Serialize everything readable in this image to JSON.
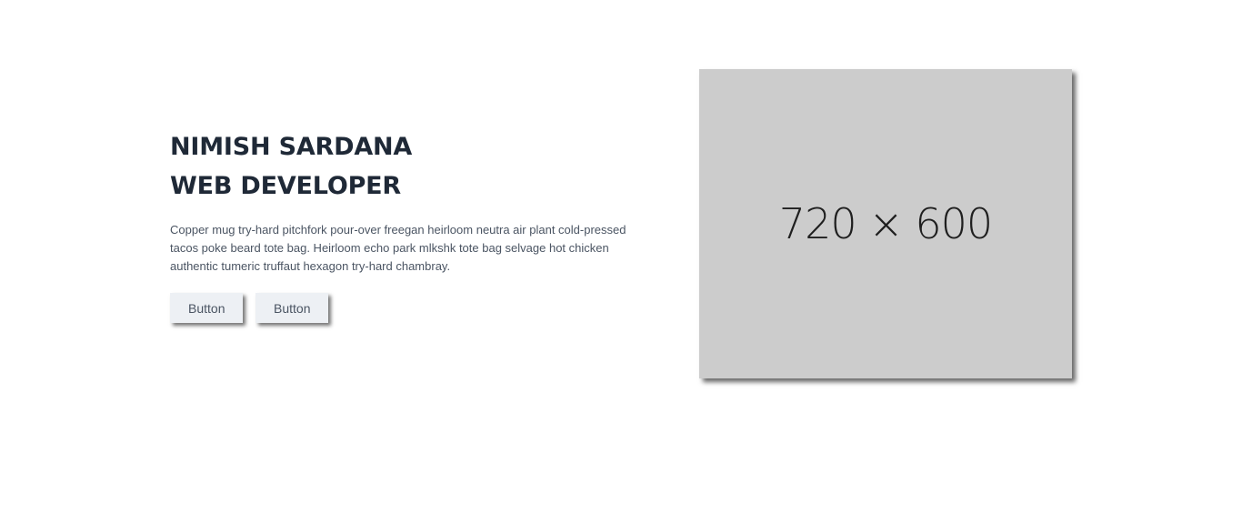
{
  "hero": {
    "title_line1": "NIMISH SARDANA",
    "title_line2": "WEB DEVELOPER",
    "description": "Copper mug try-hard pitchfork pour-over freegan heirloom neutra air plant cold-pressed tacos poke beard tote bag. Heirloom echo park mlkshk tote bag selvage hot chicken authentic tumeric truffaut hexagon try-hard chambray.",
    "buttons": [
      {
        "label": "Button"
      },
      {
        "label": "Button"
      }
    ]
  },
  "image": {
    "placeholder_text": "720 × 600",
    "background": "#cccccc"
  }
}
